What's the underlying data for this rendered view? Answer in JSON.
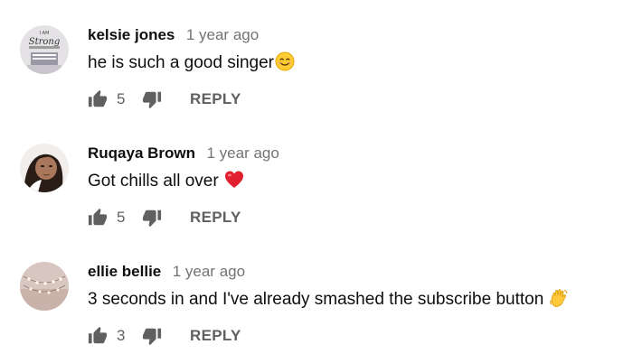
{
  "comments": [
    {
      "author": "kelsie jones",
      "time": "1 year ago",
      "text": "he is such a good singer",
      "emoji": "smiling-face-emoji",
      "likes": "5",
      "reply_label": "REPLY"
    },
    {
      "author": "Ruqaya Brown",
      "time": "1 year ago",
      "text": "Got chills all over",
      "emoji": "red-heart-emoji",
      "likes": "5",
      "reply_label": "REPLY"
    },
    {
      "author": "ellie bellie",
      "time": "1 year ago",
      "text": "3 seconds in and I've already smashed the subscribe button",
      "emoji": "waving-hand-emoji",
      "likes": "3",
      "reply_label": "REPLY"
    }
  ],
  "avatar_lettering": {
    "c0": [
      "I AM",
      "Strong"
    ]
  },
  "colors": {
    "meta_text": "#737373",
    "action_text": "#606060",
    "icon": "#606060"
  }
}
